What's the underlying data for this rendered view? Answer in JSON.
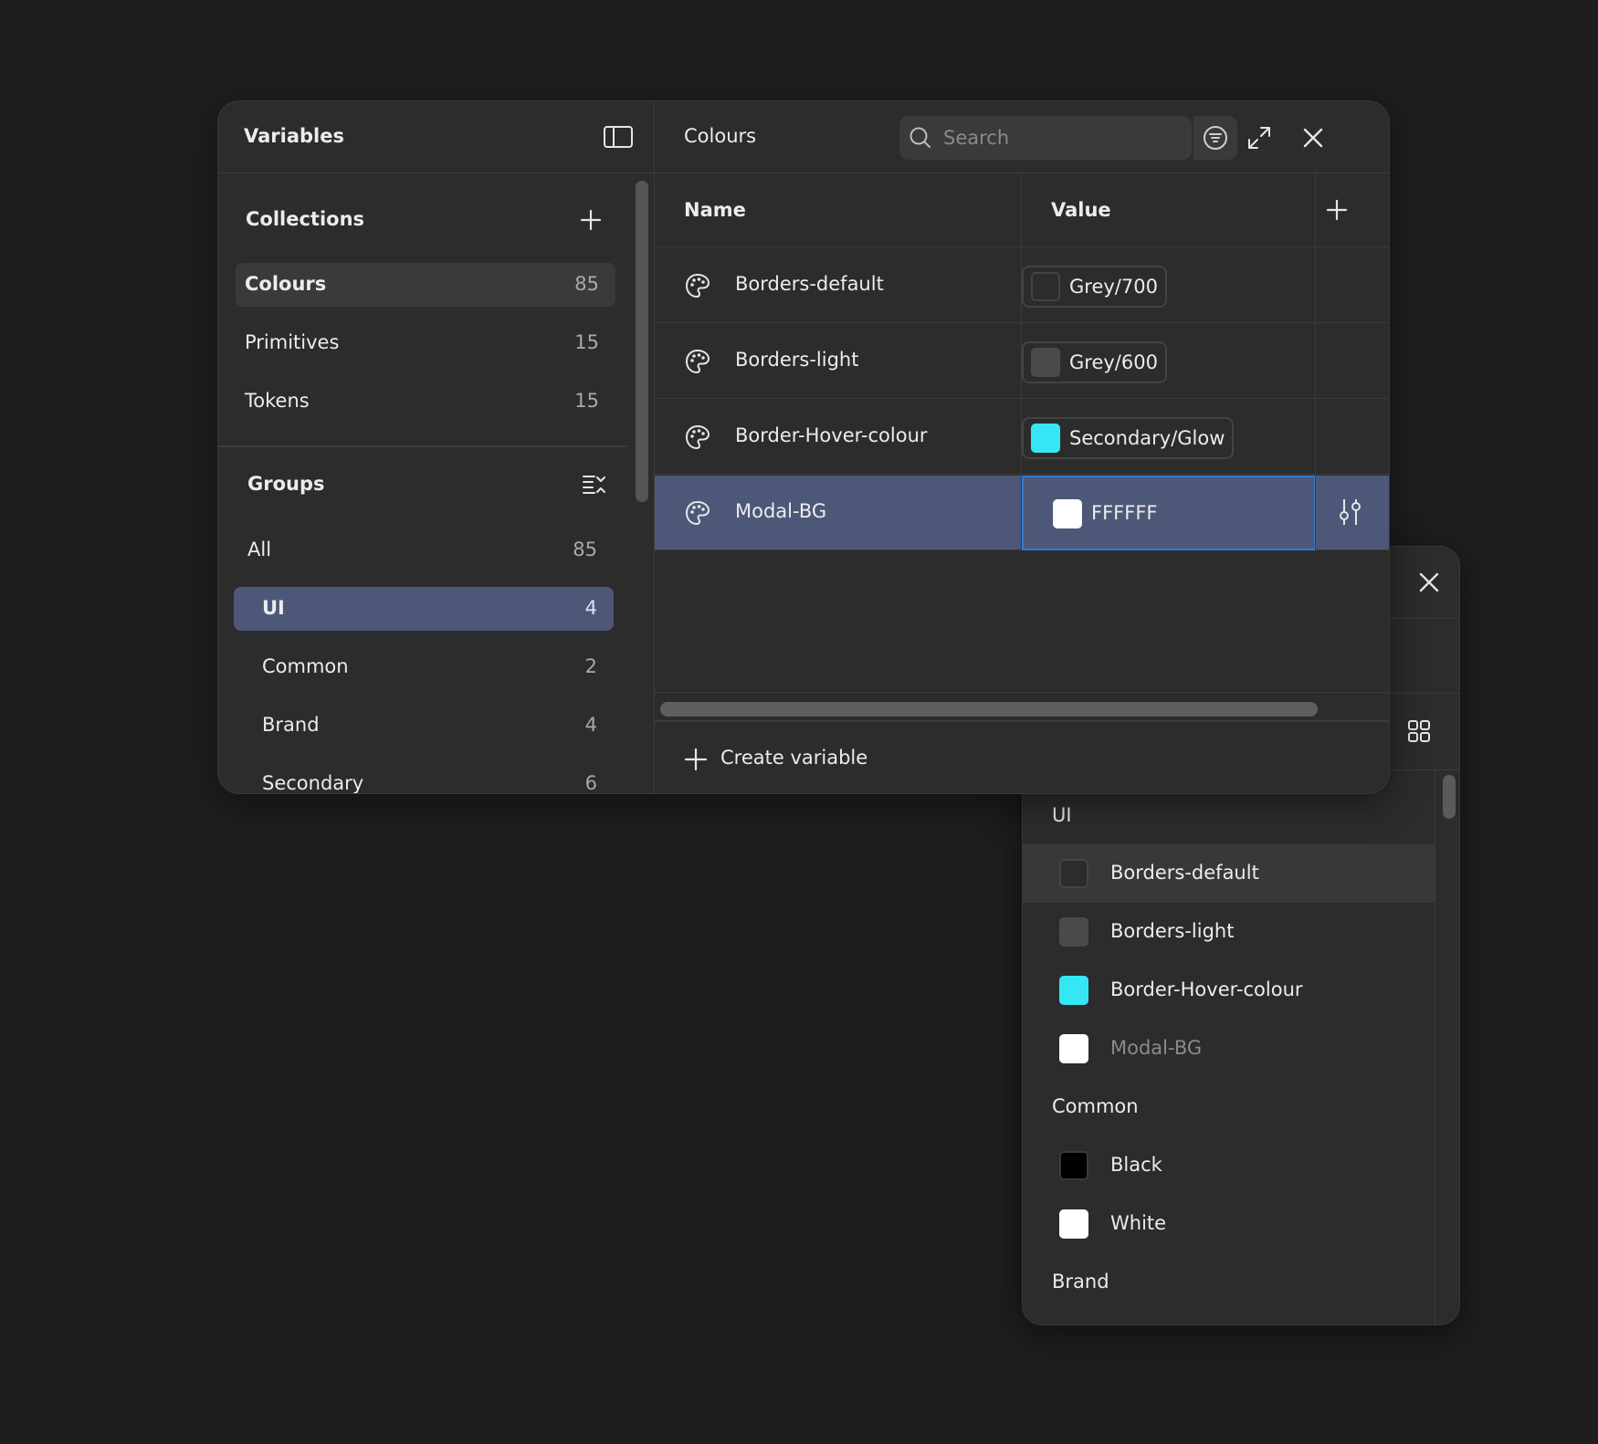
{
  "sidebar": {
    "title": "Variables",
    "collections_title": "Collections",
    "collections": [
      {
        "label": "Colours",
        "count": "85"
      },
      {
        "label": "Primitives",
        "count": "15"
      },
      {
        "label": "Tokens",
        "count": "15"
      }
    ],
    "groups_title": "Groups",
    "groups": [
      {
        "label": "All",
        "count": "85"
      },
      {
        "label": "UI",
        "count": "4"
      },
      {
        "label": "Common",
        "count": "2"
      },
      {
        "label": "Brand",
        "count": "4"
      },
      {
        "label": "Secondary",
        "count": "6"
      }
    ]
  },
  "main": {
    "title": "Colours",
    "search_placeholder": "Search",
    "columns": {
      "name": "Name",
      "value": "Value"
    },
    "rows": [
      {
        "name": "Borders-default",
        "value": "Grey/700",
        "swatch": "#2c2c2c"
      },
      {
        "name": "Borders-light",
        "value": "Grey/600",
        "swatch": "#4a4a4a"
      },
      {
        "name": "Border-Hover-colour",
        "value": "Secondary/Glow",
        "swatch": "#35e6f5"
      },
      {
        "name": "Modal-BG",
        "value": "FFFFFF",
        "swatch": "#ffffff"
      }
    ],
    "create_label": "Create variable"
  },
  "popover": {
    "groups": [
      {
        "label": "UI",
        "items": [
          {
            "name": "Borders-default",
            "swatch": "#2c2c2c"
          },
          {
            "name": "Borders-light",
            "swatch": "#4a4a4a"
          },
          {
            "name": "Border-Hover-colour",
            "swatch": "#35e6f5"
          },
          {
            "name": "Modal-BG",
            "swatch": "#ffffff"
          }
        ]
      },
      {
        "label": "Common",
        "items": [
          {
            "name": "Black",
            "swatch": "#000000"
          },
          {
            "name": "White",
            "swatch": "#ffffff"
          }
        ]
      },
      {
        "label": "Brand",
        "items": []
      }
    ]
  },
  "colors": {
    "selection": "#4d5878",
    "focus_border": "#2e7cd6",
    "background": "#1e1e1e",
    "panel": "#2c2c2c"
  }
}
